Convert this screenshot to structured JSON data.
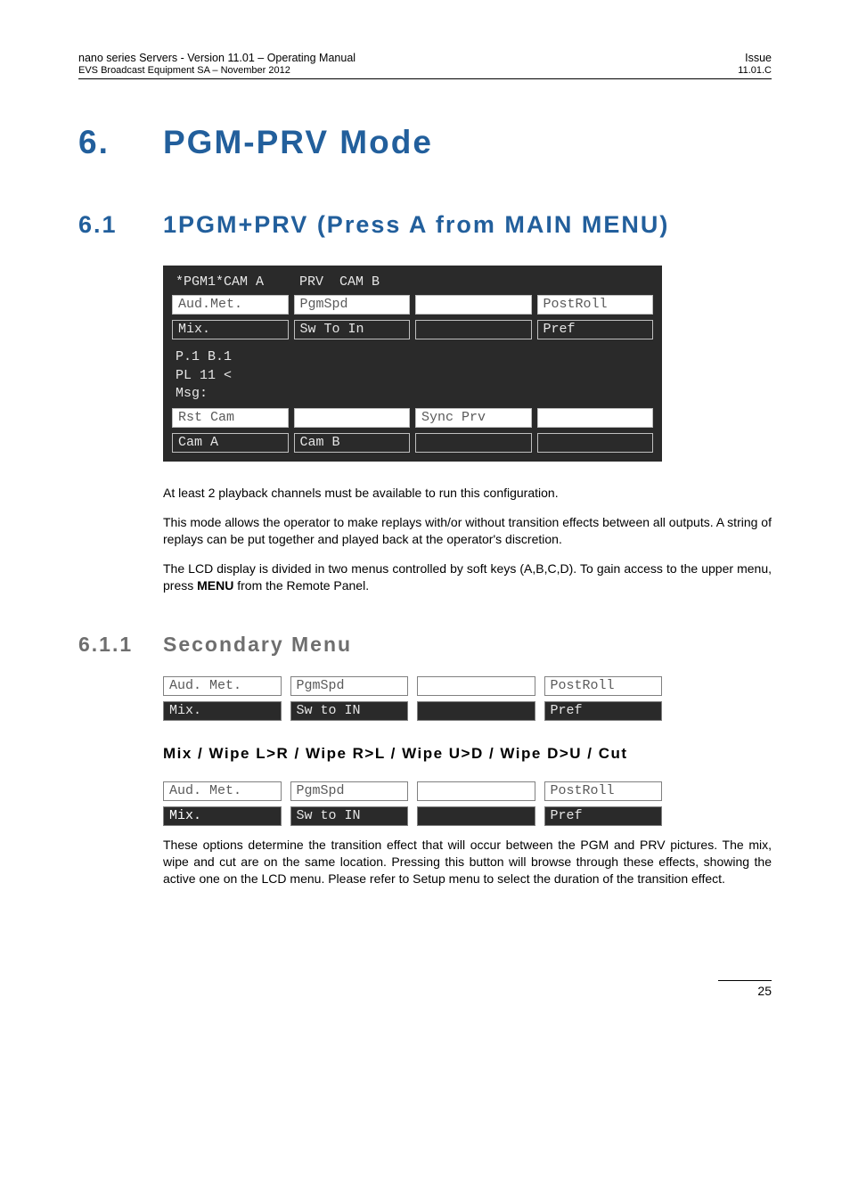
{
  "header": {
    "left_top": "nano series Servers - Version 11.01 – Operating Manual",
    "right_top": "Issue",
    "left_sub": "EVS Broadcast Equipment SA – November 2012",
    "right_sub": "11.01.C"
  },
  "h1": {
    "num": "6.",
    "text": "PGM-PRV  Mode"
  },
  "h2": {
    "num": "6.1",
    "text": "1PGM+PRV  (Press  A  from  MAIN MENU)"
  },
  "lcd": {
    "title_left": "*PGM1*CAM A",
    "title_right": "PRV  CAM B",
    "row1": [
      "Aud.Met.",
      "PgmSpd",
      "",
      "PostRoll"
    ],
    "row2": [
      "Mix.",
      "Sw To In",
      "",
      "Pref"
    ],
    "mid_lines": "P.1 B.1\nPL 11 <\nMsg:",
    "row3": [
      "Rst Cam",
      "",
      "Sync Prv",
      ""
    ],
    "row4": [
      "Cam A",
      "Cam B",
      "",
      ""
    ]
  },
  "p1": "At least 2 playback channels must be available to run this configuration.",
  "p2": "This mode allows the operator to make replays with/or without transition effects between all outputs. A string of replays can be put together and played back at the operator's discretion.",
  "p3a": "The LCD display is divided in two menus controlled by soft keys (A,B,C,D). To gain access to the upper menu, press ",
  "p3b": "MENU",
  "p3c": " from the Remote Panel.",
  "h3": {
    "num": "6.1.1",
    "text": "Secondary  Menu"
  },
  "menu1": {
    "row1": [
      "Aud. Met.",
      "PgmSpd",
      "",
      "PostRoll"
    ],
    "row2": [
      "Mix.",
      "Sw to IN",
      "",
      "Pref"
    ]
  },
  "h4": "Mix  /  Wipe  L>R  /  Wipe  R>L  /  Wipe  U>D  /  Wipe  D>U  / Cut",
  "menu2": {
    "row1": [
      "Aud. Met.",
      "PgmSpd",
      "",
      "PostRoll"
    ],
    "row2": [
      "Mix.",
      "Sw to IN",
      "",
      "Pref"
    ]
  },
  "p4": "These options determine the transition effect that will occur between the PGM and PRV pictures. The mix, wipe and cut are on the same location. Pressing this button will browse through these effects, showing the active one on the LCD menu.  Please refer to Setup menu to select the duration of the transition effect.",
  "page_number": "25"
}
